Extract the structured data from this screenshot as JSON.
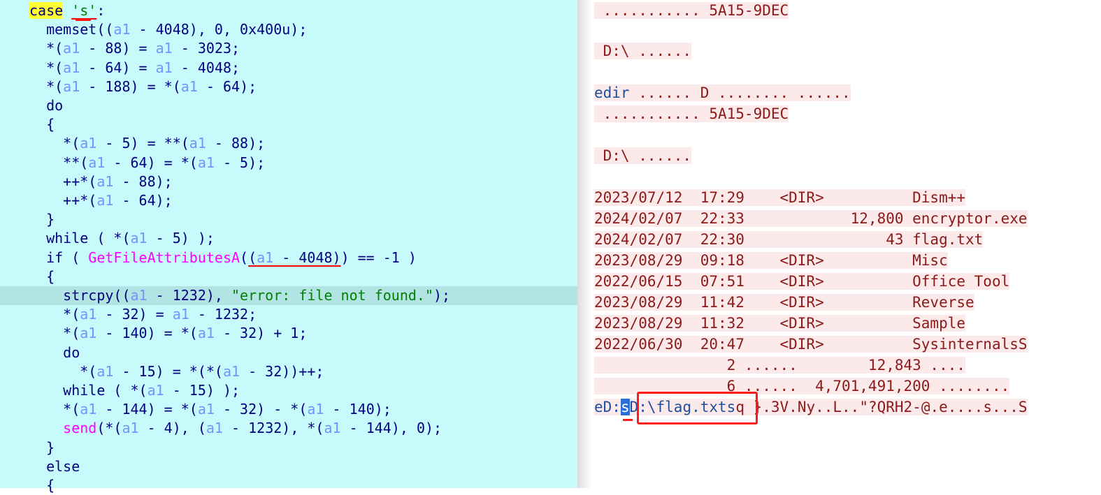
{
  "code": {
    "lines": [
      "case 's':",
      "  memset((a1 - 4048), 0, 0x400u);",
      "  *(a1 - 88) = a1 - 3023;",
      "  *(a1 - 64) = a1 - 4048;",
      "  *(a1 - 188) = *(a1 - 64);",
      "  do",
      "  {",
      "    *(a1 - 5) = **(a1 - 88);",
      "    **(a1 - 64) = *(a1 - 5);",
      "    ++*(a1 - 88);",
      "    ++*(a1 - 64);",
      "  }",
      "  while ( *(a1 - 5) );",
      "  if ( GetFileAttributesA((a1 - 4048)) == -1 )",
      "  {",
      "    strcpy((a1 - 1232), \"error: file not found.\");",
      "    *(a1 - 32) = a1 - 1232;",
      "    *(a1 - 140) = *(a1 - 32) + 1;",
      "    do",
      "      *(a1 - 15) = *(*(a1 - 32))++;",
      "    while ( *(a1 - 15) );",
      "    *(a1 - 144) = *(a1 - 32) - *(a1 - 140);",
      "    send(*(a1 - 4), (a1 - 1232), *(a1 - 144), 0);",
      "  }",
      "  else",
      "  {"
    ],
    "highlighted_line_index": 15
  },
  "dump": {
    "lines": [
      " ........... 5A15-9DEC",
      " D:\\ ......",
      "edir ...... D ........ ......",
      " ........... 5A15-9DEC",
      " D:\\ ......",
      "2023/07/12  17:29    <DIR>          Dism++",
      "2024/02/07  22:33            12,800 encryptor.exe",
      "2024/02/07  22:30                43 flag.txt",
      "2023/08/29  09:18    <DIR>          Misc",
      "2022/06/15  07:51    <DIR>          Office Tool",
      "2023/08/29  11:42    <DIR>          Reverse",
      "2023/08/29  11:32    <DIR>          Sample",
      "2022/06/30  20:47    <DIR>          SysinternalsS",
      "               2 ......        12,843 ....",
      "               6 ......  4,701,491,200 ........",
      "eD:sD:\\flag.txtsq }.3V.Ny..L..\"?QRH2-@.e....s...S"
    ]
  },
  "colors": {
    "code_bg": "#c7fbfb",
    "code_highlight_bg": "#b1e4e3",
    "dump_bg": "#fce9e9",
    "annotation_red": "#ff1a1a",
    "selection_blue": "#2b6fd6"
  }
}
